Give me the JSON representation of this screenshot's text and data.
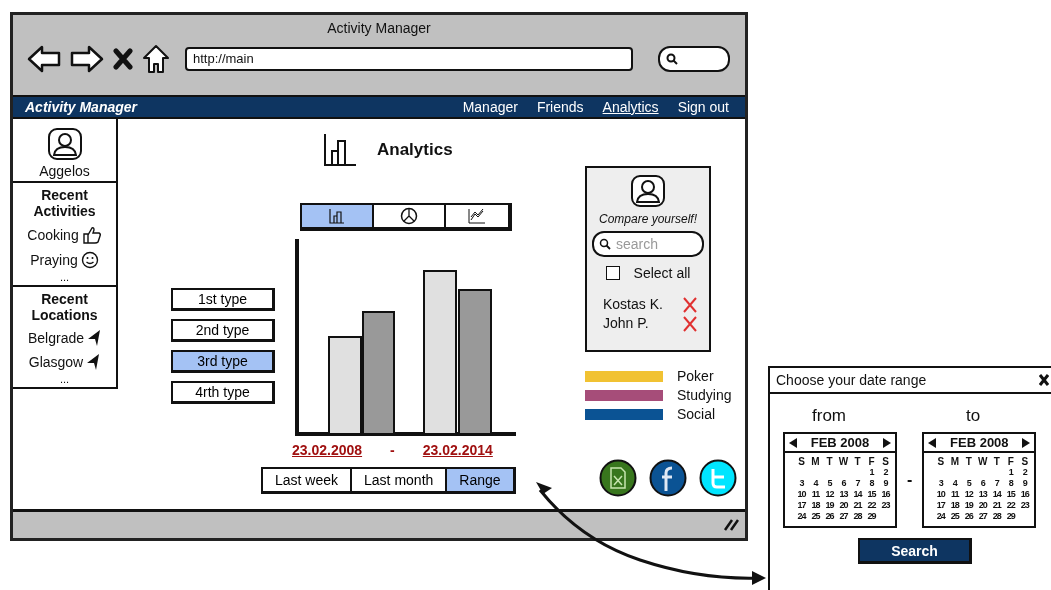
{
  "window": {
    "title": "Activity Manager",
    "url": "http://main"
  },
  "navbar": {
    "brand": "Activity Manager",
    "links": [
      {
        "label": "Manager",
        "selected": false
      },
      {
        "label": "Friends",
        "selected": false
      },
      {
        "label": "Analytics",
        "selected": true
      },
      {
        "label": "Sign out",
        "selected": false
      }
    ]
  },
  "sidebar": {
    "user": "Aggelos",
    "sections": [
      {
        "title": "Recent Activities",
        "items": [
          {
            "label": "Cooking",
            "kind": "like"
          },
          {
            "label": "Praying",
            "kind": "smile"
          }
        ],
        "more": "..."
      },
      {
        "title": "Recent Locations",
        "items": [
          {
            "label": "Belgrade",
            "kind": "location"
          },
          {
            "label": "Glasgow",
            "kind": "location"
          }
        ],
        "more": "..."
      }
    ]
  },
  "page": {
    "title": "Analytics"
  },
  "chart_types": [
    {
      "kind": "bar",
      "selected": true
    },
    {
      "kind": "pie",
      "selected": false
    },
    {
      "kind": "line",
      "selected": false
    }
  ],
  "activity_types": [
    {
      "label": "1st type",
      "selected": false
    },
    {
      "label": "2nd type",
      "selected": false
    },
    {
      "label": "3rd type",
      "selected": true
    },
    {
      "label": "4rth type",
      "selected": false
    }
  ],
  "date_range": {
    "from": "23.02.2008",
    "separator": "-",
    "to": "23.02.2014"
  },
  "periods": [
    {
      "label": "Last week",
      "selected": false
    },
    {
      "label": "Last month",
      "selected": false
    },
    {
      "label": "Range",
      "selected": true
    }
  ],
  "compare": {
    "heading": "Compare yourself!",
    "search_placeholder": "search",
    "select_all": {
      "label": "Select all",
      "checked": false
    },
    "people": [
      "Kostas K.",
      "John P."
    ]
  },
  "legend": [
    {
      "label": "Poker",
      "color": "#f1c232"
    },
    {
      "label": "Studying",
      "color": "#a64d79"
    },
    {
      "label": "Social",
      "color": "#0b5394"
    }
  ],
  "share": [
    {
      "kind": "excel"
    },
    {
      "kind": "facebook"
    },
    {
      "kind": "twitter"
    }
  ],
  "date_dialog": {
    "title": "Choose your date range",
    "from_label": "from",
    "to_label": "to",
    "separator": "-",
    "button": "Search",
    "calendars": [
      {
        "month": "FEB 2008",
        "weekdays": [
          "S",
          "M",
          "T",
          "W",
          "T",
          "F",
          "S"
        ],
        "weeks": [
          [
            "1",
            "2"
          ],
          [
            "3",
            "4",
            "5",
            "6",
            "7",
            "8",
            "9"
          ],
          [
            "10",
            "11",
            "12",
            "13",
            "14",
            "15",
            "16"
          ],
          [
            "17",
            "18",
            "19",
            "20",
            "21",
            "22",
            "23"
          ],
          [
            "24",
            "25",
            "26",
            "27",
            "28",
            "29"
          ]
        ]
      },
      {
        "month": "FEB 2008",
        "weekdays": [
          "S",
          "M",
          "T",
          "W",
          "T",
          "F",
          "S"
        ],
        "weeks": [
          [
            "1",
            "2"
          ],
          [
            "3",
            "4",
            "5",
            "6",
            "7",
            "8",
            "9"
          ],
          [
            "10",
            "11",
            "12",
            "13",
            "14",
            "15",
            "16"
          ],
          [
            "17",
            "18",
            "19",
            "20",
            "21",
            "22",
            "23"
          ],
          [
            "24",
            "25",
            "26",
            "27",
            "28",
            "29"
          ]
        ]
      }
    ]
  }
}
